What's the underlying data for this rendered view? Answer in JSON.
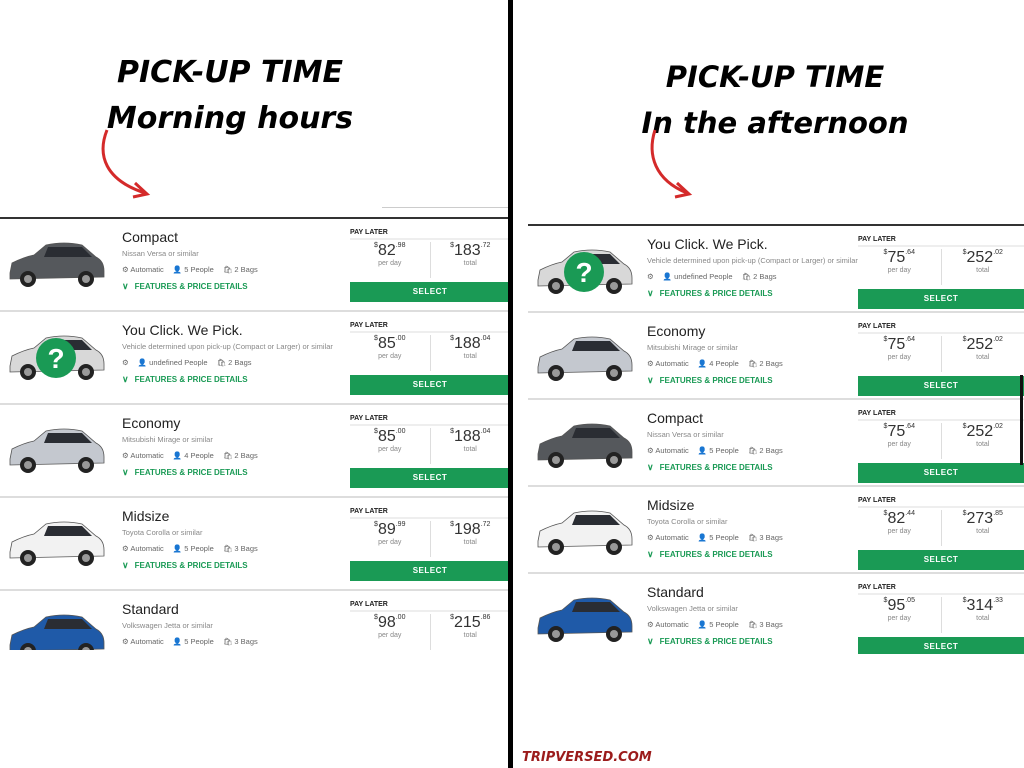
{
  "left": {
    "heading_line1": "PICK-UP TIME",
    "heading_line2": "Morning hours",
    "cars": [
      {
        "name": "Compact",
        "sub": "Nissan Versa or similar",
        "trans": "Automatic",
        "people": "5 People",
        "bags": "2 Bags",
        "day_whole": "82",
        "day_cents": ".98",
        "total_whole": "183",
        "total_cents": ".72",
        "color": "#55585c",
        "mystery": false
      },
      {
        "name": "You Click. We Pick.",
        "sub": "Vehicle determined upon pick-up (Compact or Larger) or similar",
        "trans": "",
        "people": "undefined People",
        "bags": "2 Bags",
        "day_whole": "85",
        "day_cents": ".00",
        "total_whole": "188",
        "total_cents": ".04",
        "color": "#d8d8d8",
        "mystery": true
      },
      {
        "name": "Economy",
        "sub": "Mitsubishi Mirage or similar",
        "trans": "Automatic",
        "people": "4 People",
        "bags": "2 Bags",
        "day_whole": "85",
        "day_cents": ".00",
        "total_whole": "188",
        "total_cents": ".04",
        "color": "#c4c8cf",
        "mystery": false
      },
      {
        "name": "Midsize",
        "sub": "Toyota Corolla or similar",
        "trans": "Automatic",
        "people": "5 People",
        "bags": "3 Bags",
        "day_whole": "89",
        "day_cents": ".99",
        "total_whole": "198",
        "total_cents": ".72",
        "color": "#f2f2f2",
        "mystery": false
      },
      {
        "name": "Standard",
        "sub": "Volkswagen Jetta or similar",
        "trans": "Automatic",
        "people": "5 People",
        "bags": "3 Bags",
        "day_whole": "98",
        "day_cents": ".00",
        "total_whole": "215",
        "total_cents": ".86",
        "color": "#1f5aa8",
        "mystery": false
      }
    ]
  },
  "right": {
    "heading_line1": "PICK-UP TIME",
    "heading_line2": "In the afternoon",
    "cars": [
      {
        "name": "You Click. We Pick.",
        "sub": "Vehicle determined upon pick-up (Compact or Larger) or similar",
        "trans": "",
        "people": "undefined People",
        "bags": "2 Bags",
        "day_whole": "75",
        "day_cents": ".64",
        "total_whole": "252",
        "total_cents": ".02",
        "color": "#d8d8d8",
        "mystery": true
      },
      {
        "name": "Economy",
        "sub": "Mitsubishi Mirage or similar",
        "trans": "Automatic",
        "people": "4 People",
        "bags": "2 Bags",
        "day_whole": "75",
        "day_cents": ".64",
        "total_whole": "252",
        "total_cents": ".02",
        "color": "#c4c8cf",
        "mystery": false
      },
      {
        "name": "Compact",
        "sub": "Nissan Versa or similar",
        "trans": "Automatic",
        "people": "5 People",
        "bags": "2 Bags",
        "day_whole": "75",
        "day_cents": ".64",
        "total_whole": "252",
        "total_cents": ".02",
        "color": "#55585c",
        "mystery": false
      },
      {
        "name": "Midsize",
        "sub": "Toyota Corolla or similar",
        "trans": "Automatic",
        "people": "5 People",
        "bags": "3 Bags",
        "day_whole": "82",
        "day_cents": ".44",
        "total_whole": "273",
        "total_cents": ".85",
        "color": "#f2f2f2",
        "mystery": false
      },
      {
        "name": "Standard",
        "sub": "Volkswagen Jetta or similar",
        "trans": "Automatic",
        "people": "5 People",
        "bags": "3 Bags",
        "day_whole": "95",
        "day_cents": ".05",
        "total_whole": "314",
        "total_cents": ".33",
        "color": "#1f5aa8",
        "mystery": false
      }
    ]
  },
  "labels": {
    "pay_later": "PAY LATER",
    "per_day": "per day",
    "total": "total",
    "select": "SELECT",
    "features": "FEATURES & PRICE DETAILS",
    "currency": "$"
  },
  "watermark": "TRIPVERSED.COM",
  "colors": {
    "accent": "#1a9a55",
    "arrow": "#d42a2a",
    "watermark": "#9b1b1b"
  }
}
